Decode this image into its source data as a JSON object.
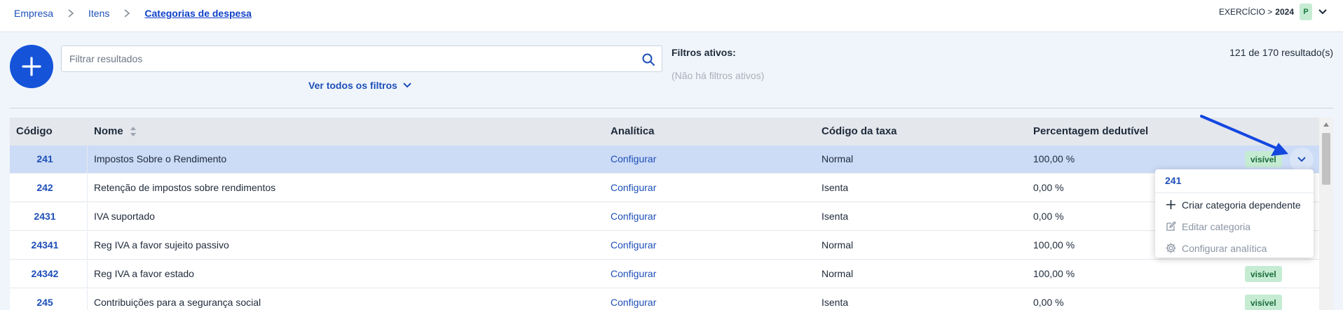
{
  "breadcrumb": {
    "items": [
      "Empresa",
      "Itens"
    ],
    "current": "Categorias de despesa"
  },
  "exercise": {
    "label": "EXERCÍCIO >",
    "year": "2024",
    "badge": "P"
  },
  "search": {
    "placeholder": "Filtrar resultados"
  },
  "filters": {
    "all_filters_label": "Ver todos os filtros",
    "active_title": "Filtros ativos:",
    "active_empty": "(Não há filtros ativos)"
  },
  "results": "121 de 170 resultado(s)",
  "table": {
    "headers": {
      "code": "Código",
      "name": "Nome",
      "analytics": "Analítica",
      "tax_code": "Código da taxa",
      "deductible": "Percentagem dedutível"
    },
    "rows": [
      {
        "code": "241",
        "name": "Impostos Sobre o Rendimento",
        "analytics": "Configurar",
        "tax_code": "Normal",
        "deductible": "100,00 %",
        "status": "visível"
      },
      {
        "code": "242",
        "name": "Retenção de impostos sobre rendimentos",
        "analytics": "Configurar",
        "tax_code": "Isenta",
        "deductible": "0,00 %",
        "status": ""
      },
      {
        "code": "2431",
        "name": "IVA suportado",
        "analytics": "Configurar",
        "tax_code": "Isenta",
        "deductible": "0,00 %",
        "status": ""
      },
      {
        "code": "24341",
        "name": "Reg IVA a favor sujeito passivo",
        "analytics": "Configurar",
        "tax_code": "Normal",
        "deductible": "100,00 %",
        "status": ""
      },
      {
        "code": "24342",
        "name": "Reg IVA a favor estado",
        "analytics": "Configurar",
        "tax_code": "Normal",
        "deductible": "100,00 %",
        "status": "visível"
      },
      {
        "code": "245",
        "name": "Contribuições para a segurança social",
        "analytics": "Configurar",
        "tax_code": "Isenta",
        "deductible": "0,00 %",
        "status": "visível"
      }
    ]
  },
  "row_menu": {
    "title": "241",
    "items": [
      {
        "label": "Criar categoria dependente",
        "icon": "plus-icon",
        "enabled": true
      },
      {
        "label": "Editar categoria",
        "icon": "edit-icon",
        "enabled": false
      },
      {
        "label": "Configurar analítica",
        "icon": "gear-icon",
        "enabled": false
      }
    ]
  },
  "colors": {
    "primary": "#1553d9",
    "link": "#1d4fb8",
    "selected_row": "#ccdbf6",
    "badge_bg": "#c5ecd3",
    "badge_text": "#1a6b3a",
    "annotation": "#1447e0"
  }
}
